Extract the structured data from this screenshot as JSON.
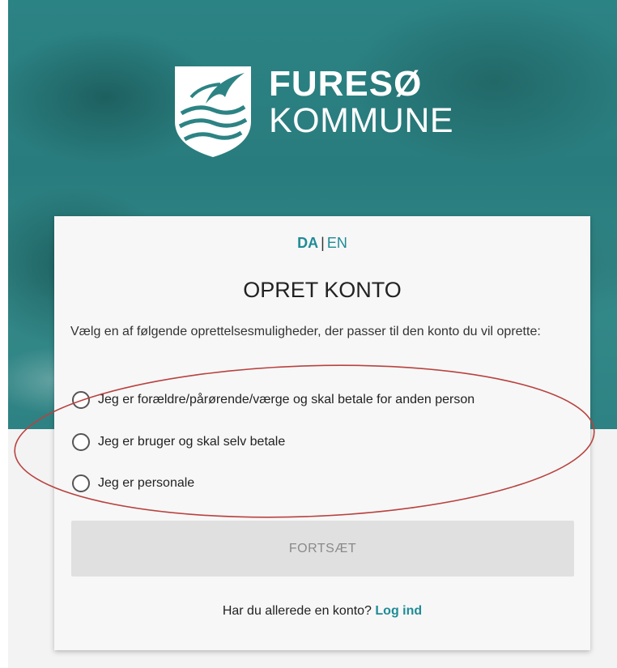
{
  "brand": {
    "line1": "FURESØ",
    "line2": "KOMMUNE",
    "logo_icon": "furesoe-crest-icon"
  },
  "language": {
    "da": "DA",
    "separator": "|",
    "en": "EN",
    "active": "DA"
  },
  "form": {
    "title": "OPRET KONTO",
    "intro": "Vælg en af følgende oprettelsesmuligheder, der passer til den konto du vil oprette:",
    "options": [
      {
        "label": "Jeg er forældre/pårørende/værge og skal betale for anden person",
        "selected": false
      },
      {
        "label": "Jeg er bruger og skal selv betale",
        "selected": false
      },
      {
        "label": "Jeg er personale",
        "selected": false
      }
    ],
    "continue_label": "FORTSÆT",
    "login_prompt": "Har du allerede en konto?",
    "login_link": "Log ind"
  },
  "colors": {
    "hero": "#2c8384",
    "accent": "#1f8b96",
    "annotation": "#b8423f",
    "button_disabled": "#e0e0e0"
  }
}
